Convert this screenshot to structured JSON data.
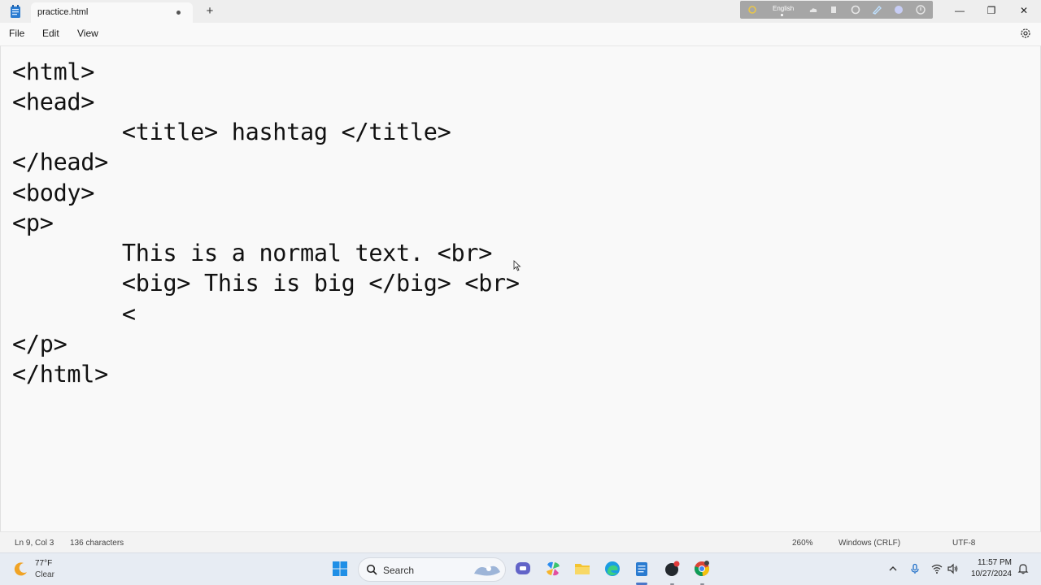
{
  "window": {
    "tab_title": "practice.html",
    "new_tab_symbol": "+",
    "controls": {
      "minimize": "—",
      "maximize": "❐",
      "close": "✕"
    }
  },
  "ime": {
    "language": "English"
  },
  "menu": {
    "file": "File",
    "edit": "Edit",
    "view": "View"
  },
  "editor": {
    "lines": [
      "<html>",
      "<head>",
      "        <title> hashtag </title>",
      "</head>",
      "<body>",
      "<p>",
      "        This is a normal text. <br>",
      "        <big> This is big </big> <br>",
      "        <",
      "</p>",
      "</html>"
    ]
  },
  "status": {
    "position": "Ln 9, Col 3",
    "characters": "136 characters",
    "zoom": "260%",
    "line_ending": "Windows (CRLF)",
    "encoding": "UTF-8"
  },
  "taskbar": {
    "weather": {
      "temp": "77°F",
      "desc": "Clear"
    },
    "search_label": "Search",
    "clock": {
      "time": "11:57 PM",
      "date": "10/27/2024"
    }
  },
  "colors": {
    "accent": "#4a77c8",
    "editor_bg": "#f9f9f9",
    "taskbar_bg": "#e7ecf3"
  }
}
